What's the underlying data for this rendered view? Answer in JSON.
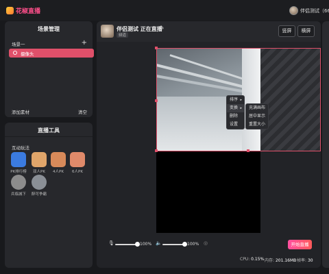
{
  "app": {
    "name": "花椒直播",
    "user_name": "伴侣测试（66"
  },
  "scene_panel": {
    "title": "场景管理",
    "scene_name": "场景一",
    "add_symbol": "+",
    "sources": [
      {
        "label": "摄像头"
      }
    ],
    "add_material": "添加素材",
    "clear": "清空"
  },
  "tools_panel": {
    "title": "直播工具",
    "section": "互动玩法",
    "tools": [
      {
        "label": "PK排行榜",
        "color": "#3b7be0"
      },
      {
        "label": "双人PK",
        "color": "#e0a56a"
      },
      {
        "label": "4人PK",
        "color": "#d88a5a"
      },
      {
        "label": "6人PK",
        "color": "#e08a6a"
      },
      {
        "label": "兵临城下",
        "color": "#8c8c8c"
      },
      {
        "label": "醉可争霸",
        "color": "#8a8f96"
      }
    ]
  },
  "main": {
    "host_title": "伴侣测试 正在直播",
    "badge": "频道",
    "edit_icon": "✎",
    "mode_portrait": "竖屏",
    "mode_landscape": "横屏"
  },
  "context_menu": {
    "items": [
      {
        "label": "排序",
        "arrow": "▸"
      },
      {
        "label": "变换",
        "arrow": "▸"
      },
      {
        "label": "删除"
      },
      {
        "label": "设置"
      }
    ],
    "submenu": [
      {
        "label": "充满画布"
      },
      {
        "label": "居中显示"
      },
      {
        "label": "重置大小"
      }
    ]
  },
  "controls": {
    "mic_icon": "🎙",
    "mic_level": "100%",
    "speaker_icon": "🔈",
    "speaker_level": "100%",
    "settings_icon": "◎",
    "start_label": "开始直播",
    "mic_level_value": 100,
    "speaker_level_value": 100
  },
  "stats": {
    "cpu_label": "CPU:",
    "cpu": "0.15%",
    "mem_label": "内存:",
    "mem": "201.16MB",
    "fps_label": "帧率:",
    "fps": "30"
  }
}
